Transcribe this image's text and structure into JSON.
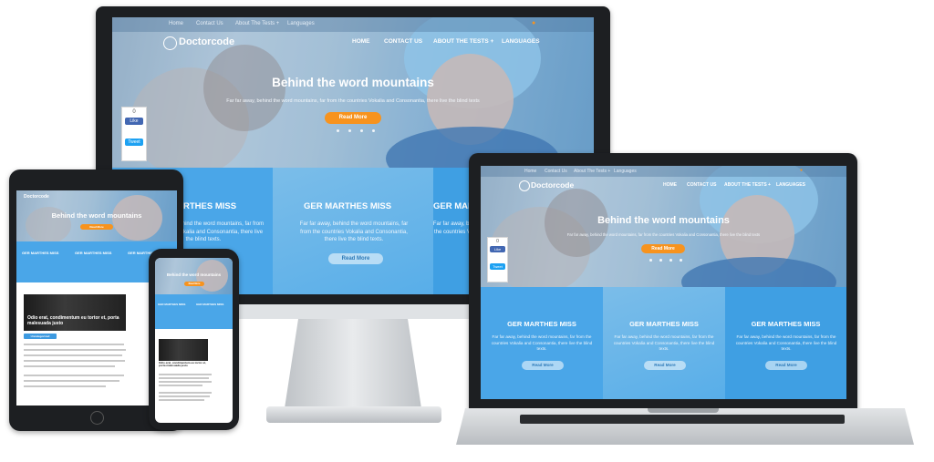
{
  "site": {
    "logo": "Doctorcode",
    "top_links": [
      "Home",
      "Contact Us",
      "About The Tests +",
      "Languages"
    ],
    "nav": [
      "HOME",
      "CONTACT US",
      "ABOUT THE TESTS +",
      "LANGUAGES"
    ],
    "hero_title": "Behind the word mountains",
    "hero_subtitle": "Far far away, behind the word mountains, far from the countries Vokalia and Consonantia, there live the blind texts",
    "hero_button": "Read More",
    "social": {
      "count": "0",
      "like": "Like",
      "tweet": "Tweet"
    },
    "feature_title": "GER MARTHES MISS",
    "feature_text": "Far far away, behind the word mountains, far from the countries Vokalia and Consonantia, there live the blind texts.",
    "feature_button": "Read More",
    "blog_caption": "Odio erat, condimentum eu tortor et, porta malesuada justo",
    "blog_tag": "Uncategorized",
    "read_more": "Read More"
  },
  "colors": {
    "accent": "#f7931e",
    "primary": "#4aa6e8",
    "dark": "#1d1f22"
  }
}
